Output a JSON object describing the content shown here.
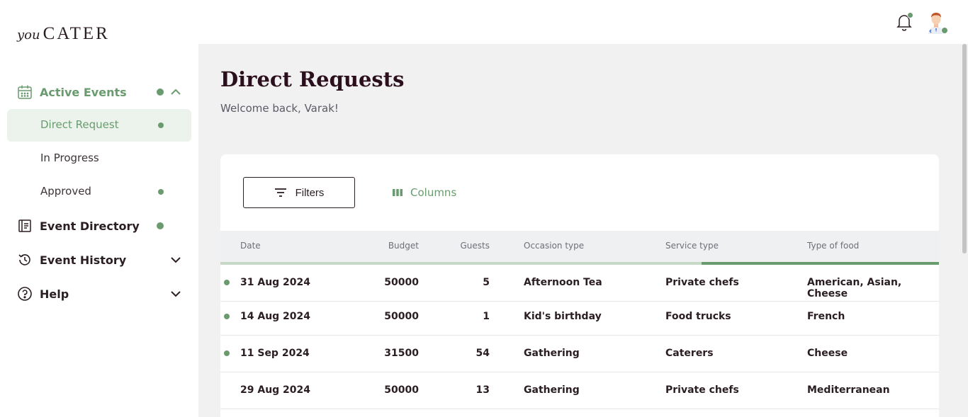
{
  "brand": {
    "logo_script": "you",
    "logo_main": "CATER"
  },
  "sidebar": {
    "active_events": {
      "label": "Active Events",
      "icon": "calendar-icon"
    },
    "sub_items": [
      {
        "label": "Direct Request",
        "has_dot": true,
        "selected": true
      },
      {
        "label": "In Progress",
        "has_dot": false,
        "selected": false
      },
      {
        "label": "Approved",
        "has_dot": true,
        "selected": false
      }
    ],
    "event_directory": {
      "label": "Event Directory",
      "icon": "directory-icon"
    },
    "event_history": {
      "label": "Event History",
      "icon": "history-icon"
    },
    "help": {
      "label": "Help",
      "icon": "help-icon"
    }
  },
  "header": {
    "notification_icon": "bell-icon",
    "avatar_icon": "user-avatar"
  },
  "main": {
    "title": "Direct Requests",
    "welcome": "Welcome back, Varak!",
    "toolbar": {
      "filters_label": "Filters",
      "columns_label": "Columns"
    }
  },
  "table": {
    "columns": [
      "Date",
      "Budget",
      "Guests",
      "Occasion type",
      "Service type",
      "Type of food"
    ],
    "rows": [
      {
        "unread": true,
        "date": "31 Aug 2024",
        "budget": "50000",
        "guests": "5",
        "occasion": "Afternoon Tea",
        "service": "Private chefs",
        "food": "American, Asian, Cheese"
      },
      {
        "unread": true,
        "date": "14 Aug 2024",
        "budget": "50000",
        "guests": "1",
        "occasion": "Kid's birthday",
        "service": "Food trucks",
        "food": "French"
      },
      {
        "unread": true,
        "date": "11 Sep 2024",
        "budget": "31500",
        "guests": "54",
        "occasion": "Gathering",
        "service": "Caterers",
        "food": "Cheese"
      },
      {
        "unread": false,
        "date": "29 Aug 2024",
        "budget": "50000",
        "guests": "13",
        "occasion": "Gathering",
        "service": "Private chefs",
        "food": "Mediterranean"
      }
    ]
  },
  "colors": {
    "accent": "#6a9b6f",
    "title": "#2b0f1c",
    "selected_bg": "#ecf3ec"
  }
}
